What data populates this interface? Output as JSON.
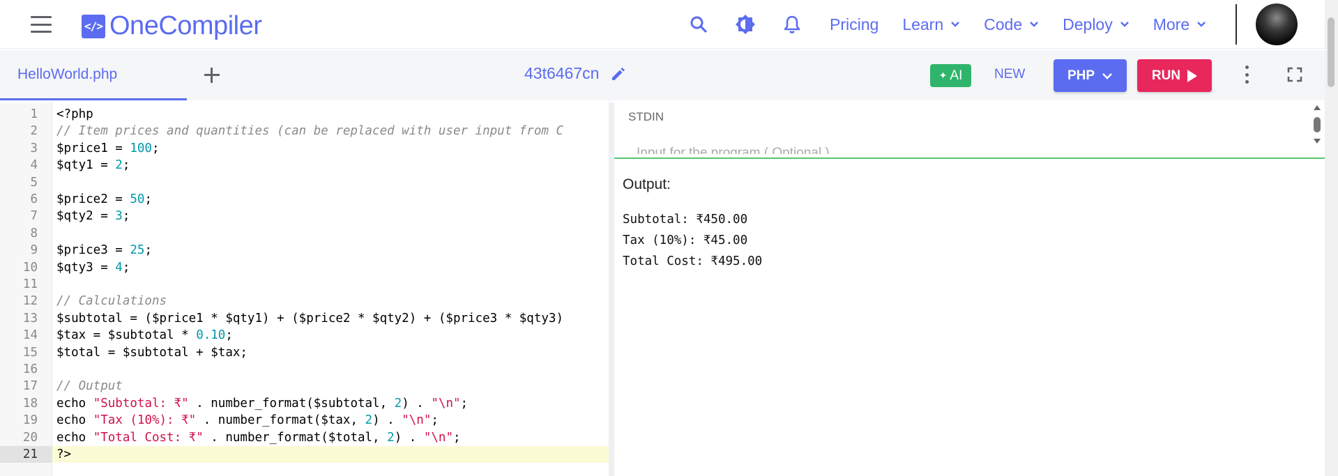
{
  "header": {
    "brand_mark": "</>",
    "brand_name": "OneCompiler",
    "nav_links": [
      "Pricing",
      "Learn",
      "Code",
      "Deploy",
      "More"
    ],
    "icons": [
      "menu-icon",
      "search-icon",
      "theme-toggle-icon",
      "bell-icon"
    ]
  },
  "toolbar": {
    "file_tab": "HelloWorld.php",
    "code_id": "43t6467cn",
    "ai_label": "AI",
    "new_label": "NEW",
    "language": "PHP",
    "run_label": "RUN"
  },
  "editor": {
    "active_line": 21,
    "lines": [
      "<?php",
      "// Item prices and quantities (can be replaced with user input from C",
      "$price1 = 100;",
      "$qty1 = 2;",
      "",
      "$price2 = 50;",
      "$qty2 = 3;",
      "",
      "$price3 = 25;",
      "$qty3 = 4;",
      "",
      "// Calculations",
      "$subtotal = ($price1 * $qty1) + ($price2 * $qty2) + ($price3 * $qty3)",
      "$tax = $subtotal * 0.10;",
      "$total = $subtotal + $tax;",
      "",
      "// Output",
      "echo \"Subtotal: ₹\" . number_format($subtotal, 2) . \"\\n\";",
      "echo \"Tax (10%): ₹\" . number_format($tax, 2) . \"\\n\";",
      "echo \"Total Cost: ₹\" . number_format($total, 2) . \"\\n\";",
      "?>"
    ]
  },
  "stdin": {
    "label": "STDIN",
    "placeholder": "Input for the program ( Optional )"
  },
  "output": {
    "label": "Output:",
    "lines": [
      "Subtotal: ₹450.00",
      "Tax (10%): ₹45.00",
      "Total Cost: ₹495.00"
    ]
  },
  "colors": {
    "brand": "#5b6cf0",
    "run": "#e8285d",
    "ai": "#2fb56b",
    "active_line": "#fbfbd6"
  }
}
